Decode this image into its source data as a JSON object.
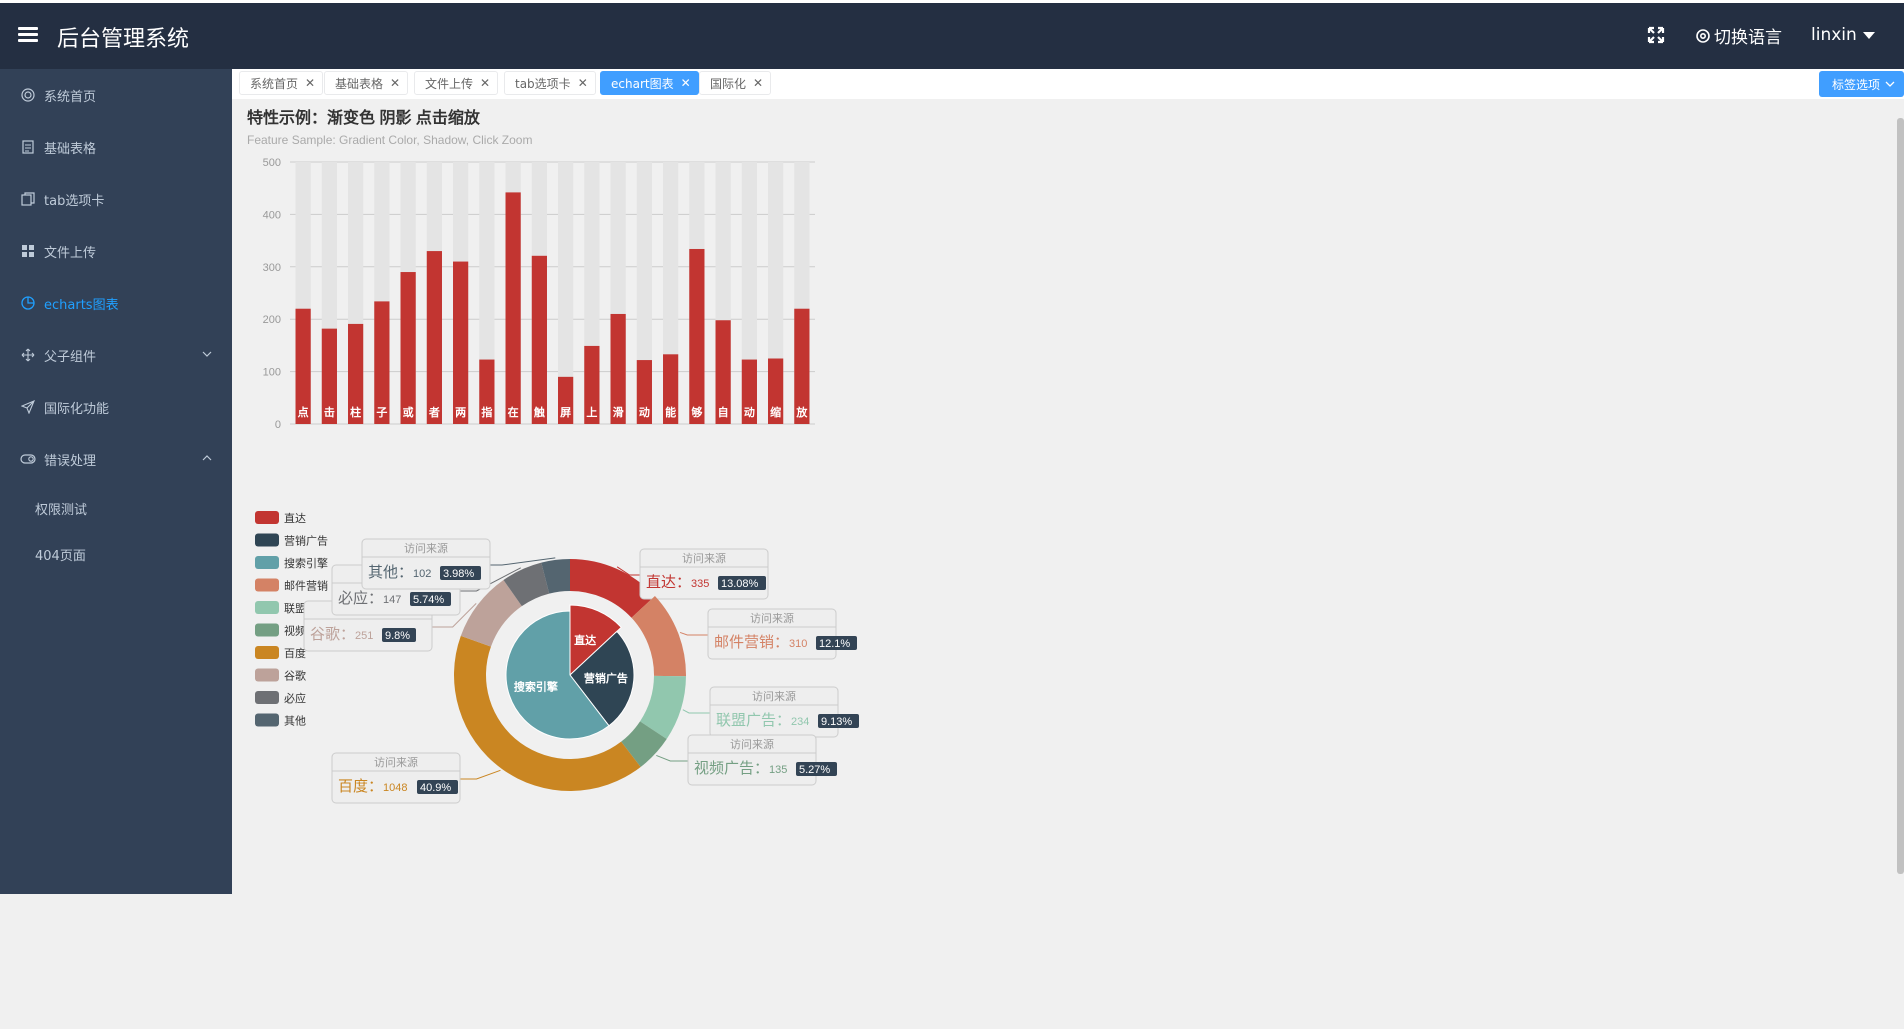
{
  "header": {
    "title": "后台管理系统",
    "lang_label": "切换语言",
    "username": "linxin"
  },
  "sidebar": {
    "items": [
      {
        "label": "系统首页",
        "icon": "home-icon"
      },
      {
        "label": "基础表格",
        "icon": "document-icon"
      },
      {
        "label": "tab选项卡",
        "icon": "copy-icon"
      },
      {
        "label": "文件上传",
        "icon": "grid-icon"
      },
      {
        "label": "echarts图表",
        "icon": "pie-chart-icon"
      },
      {
        "label": "父子组件",
        "icon": "move-icon"
      },
      {
        "label": "国际化功能",
        "icon": "send-icon"
      },
      {
        "label": "错误处理",
        "icon": "toggle-icon"
      }
    ],
    "sub_items": [
      {
        "label": "权限测试"
      },
      {
        "label": "404页面"
      }
    ]
  },
  "tags": [
    {
      "label": "系统首页"
    },
    {
      "label": "基础表格"
    },
    {
      "label": "文件上传"
    },
    {
      "label": "tab选项卡"
    },
    {
      "label": "echart图表"
    },
    {
      "label": "国际化"
    }
  ],
  "tag_options_label": "标签选项",
  "colors": {
    "header_bg": "#242f42",
    "sidebar_bg": "#324157",
    "accent": "#409eff",
    "bar": "#c23531",
    "bar_shadow": "#e4e4e4"
  },
  "chart_data": [
    {
      "type": "bar",
      "title": "特性示例：渐变色 阴影 点击缩放",
      "subtitle": "Feature Sample: Gradient Color, Shadow, Click Zoom",
      "categories": [
        "点",
        "击",
        "柱",
        "子",
        "或",
        "者",
        "两",
        "指",
        "在",
        "触",
        "屏",
        "上",
        "滑",
        "动",
        "能",
        "够",
        "自",
        "动",
        "缩",
        "放"
      ],
      "values": [
        220,
        182,
        191,
        234,
        290,
        330,
        310,
        123,
        442,
        321,
        90,
        149,
        210,
        122,
        133,
        334,
        198,
        123,
        125,
        220
      ],
      "shadow_max": 500,
      "ylim": [
        0,
        500
      ],
      "yticks": [
        "0",
        "100",
        "200",
        "300",
        "400",
        "500"
      ],
      "grid": true
    },
    {
      "type": "pie",
      "legend": [
        "直达",
        "营销广告",
        "搜索引擎",
        "邮件营销",
        "联盟广告",
        "视频广告",
        "百度",
        "谷歌",
        "必应",
        "其他"
      ],
      "legend_position": "left",
      "label_header": "访问来源",
      "inner": [
        {
          "name": "直达",
          "value": 335,
          "color": "#c23531"
        },
        {
          "name": "营销广告",
          "value": 679,
          "color": "#2f4554"
        },
        {
          "name": "搜索引擎",
          "value": 1548,
          "color": "#61a0a8"
        }
      ],
      "outer": [
        {
          "name": "直达",
          "value": 335,
          "pct": "13.08%",
          "color": "#c23531"
        },
        {
          "name": "邮件营销",
          "value": 310,
          "pct": "12.1%",
          "color": "#d48265"
        },
        {
          "name": "联盟广告",
          "value": 234,
          "pct": "9.13%",
          "color": "#91c7ae"
        },
        {
          "name": "视频广告",
          "value": 135,
          "pct": "5.27%",
          "color": "#749f83"
        },
        {
          "name": "百度",
          "value": 1048,
          "pct": "40.9%",
          "color": "#ca8622"
        },
        {
          "name": "谷歌",
          "value": 251,
          "pct": "9.8%",
          "color": "#bda29a"
        },
        {
          "name": "必应",
          "value": 147,
          "pct": "5.74%",
          "color": "#6e7074"
        },
        {
          "name": "其他",
          "value": 102,
          "pct": "3.98%",
          "color": "#546570"
        }
      ],
      "legend_colors": [
        "#c23531",
        "#2f4554",
        "#61a0a8",
        "#d48265",
        "#91c7ae",
        "#749f83",
        "#ca8622",
        "#bda29a",
        "#6e7074",
        "#546570"
      ]
    }
  ]
}
